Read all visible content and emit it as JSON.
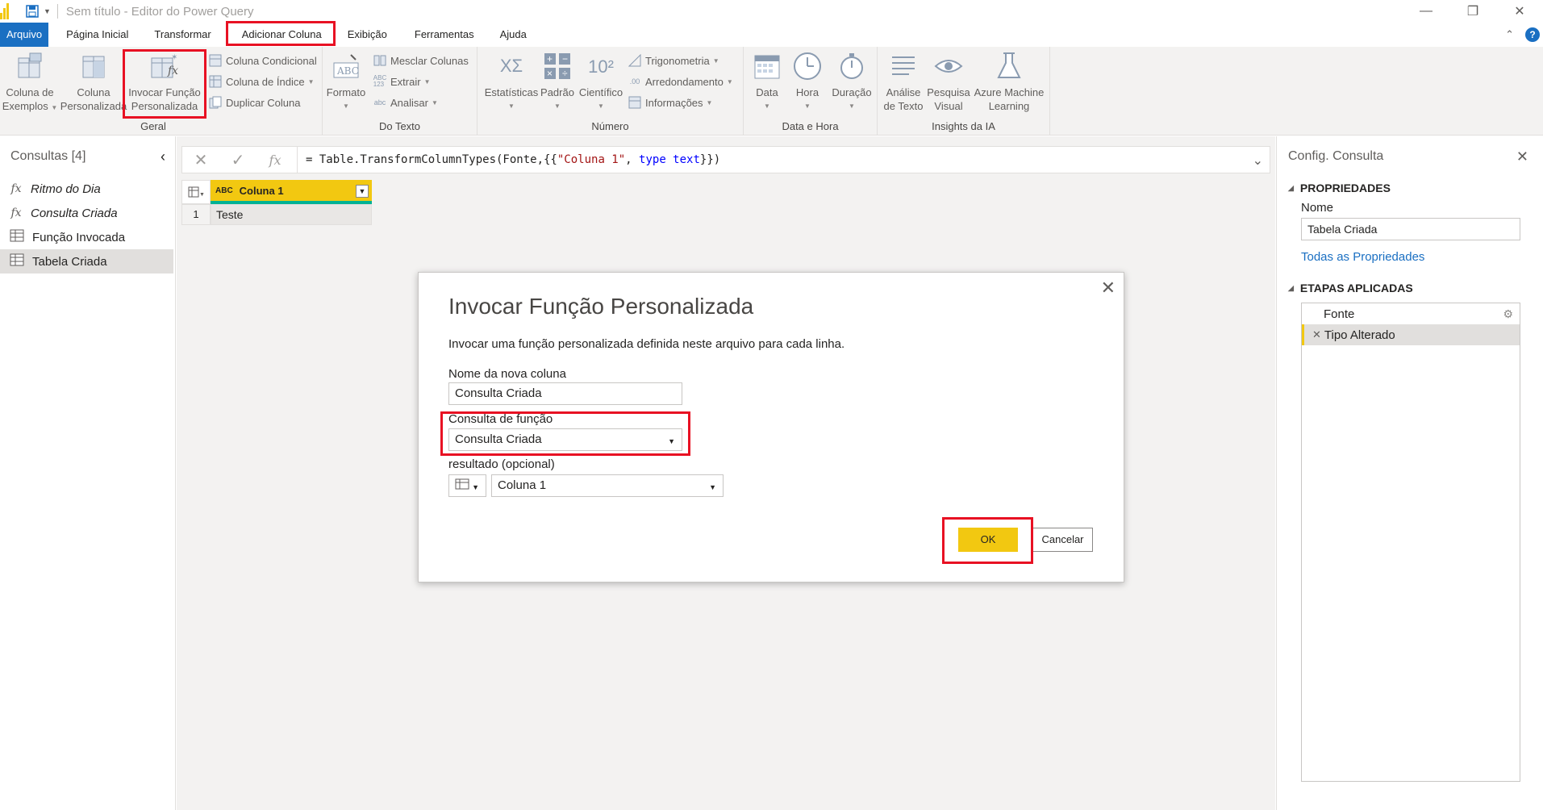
{
  "window": {
    "title": "Sem título - Editor do Power Query"
  },
  "menu": {
    "file": "Arquivo",
    "tabs": [
      "Página Inicial",
      "Transformar",
      "Adicionar Coluna",
      "Exibição",
      "Ferramentas",
      "Ajuda"
    ]
  },
  "ribbon": {
    "geral": {
      "label": "Geral",
      "col_exemplos_1": "Coluna de",
      "col_exemplos_2": "Exemplos",
      "col_pers_1": "Coluna",
      "col_pers_2": "Personalizada",
      "invocar_1": "Invocar Função",
      "invocar_2": "Personalizada",
      "condicional": "Coluna Condicional",
      "indice": "Coluna de Índice",
      "duplicar": "Duplicar Coluna"
    },
    "texto": {
      "label": "Do Texto",
      "formato": "Formato",
      "mesclar": "Mesclar Colunas",
      "extrair": "Extrair",
      "analisar": "Analisar"
    },
    "numero": {
      "label": "Número",
      "estatisticas": "Estatísticas",
      "padrao": "Padrão",
      "cientifico": "Científico",
      "trigonometria": "Trigonometria",
      "arredondamento": "Arredondamento",
      "informacoes": "Informações"
    },
    "datahora": {
      "label": "Data e Hora",
      "data": "Data",
      "hora": "Hora",
      "duracao": "Duração"
    },
    "ia": {
      "label": "Insights da IA",
      "analise_1": "Análise",
      "analise_2": "de Texto",
      "pesquisa_1": "Pesquisa",
      "pesquisa_2": "Visual",
      "azure_1": "Azure Machine",
      "azure_2": "Learning"
    }
  },
  "queries": {
    "header": "Consultas [4]",
    "items": [
      {
        "label": "Ritmo do Dia",
        "type": "function"
      },
      {
        "label": "Consulta Criada",
        "type": "function"
      },
      {
        "label": "Função Invocada",
        "type": "table"
      },
      {
        "label": "Tabela Criada",
        "type": "table"
      }
    ]
  },
  "formula": {
    "prefix": "= Table.TransformColumnTypes(Fonte,{{",
    "str": "\"Coluna 1\"",
    "mid": ", ",
    "kw": "type text",
    "suffix": "}})"
  },
  "grid": {
    "column": "Coluna 1",
    "type_badge": "ABC",
    "rows": [
      {
        "num": "1",
        "value": "Teste"
      }
    ]
  },
  "settings": {
    "header": "Config. Consulta",
    "properties_title": "PROPRIEDADES",
    "name_label": "Nome",
    "name_value": "Tabela Criada",
    "all_props_link": "Todas as Propriedades",
    "steps_title": "ETAPAS APLICADAS",
    "steps": [
      "Fonte",
      "Tipo Alterado"
    ]
  },
  "dialog": {
    "title": "Invocar Função Personalizada",
    "description": "Invocar uma função personalizada definida neste arquivo para cada linha.",
    "new_col_label": "Nome da nova coluna",
    "new_col_value": "Consulta Criada",
    "func_label": "Consulta de função",
    "func_value": "Consulta Criada",
    "result_label": "resultado (opcional)",
    "result_value": "Coluna 1",
    "ok": "OK",
    "cancel": "Cancelar"
  },
  "colors": {
    "accent_yellow": "#f2c811",
    "file_tab_blue": "#1a6fc2",
    "highlight_red": "#e81123",
    "link_blue": "#1a6fc2"
  }
}
